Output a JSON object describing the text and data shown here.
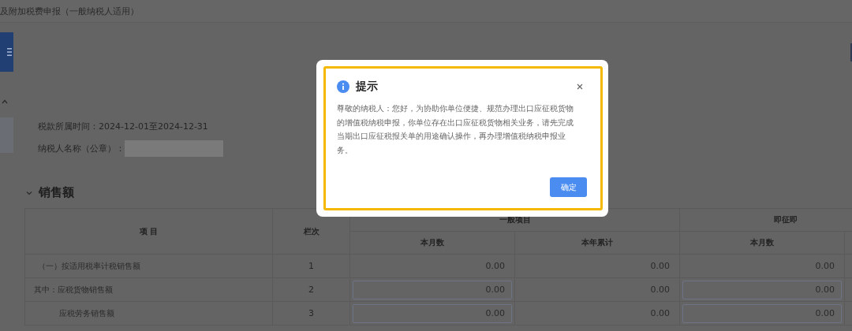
{
  "page": {
    "title": "及附加税费申报（一般纳税人适用）"
  },
  "info": {
    "period": "税款所属时间：2024-12-01至2024-12-31",
    "taxpayer_label": "纳税人名称（公章）："
  },
  "section": {
    "title": "销售额",
    "expanded": true
  },
  "table": {
    "item_header": "项 目",
    "line_header": "栏次",
    "groups": [
      {
        "title": "一般项目",
        "columns": [
          "本月数",
          "本年累计"
        ]
      },
      {
        "title": "即征即",
        "columns": [
          "本月数"
        ]
      }
    ],
    "rows": [
      {
        "kind": "main",
        "item": "（一）按适用税率计税销售额",
        "line": "1",
        "cells": [
          {
            "kind": "text",
            "value": "0.00"
          },
          {
            "kind": "text",
            "value": "0.00"
          },
          {
            "kind": "text",
            "value": "0.00"
          }
        ]
      },
      {
        "kind": "of_which",
        "item": "其中：应税货物销售额",
        "line": "2",
        "cells": [
          {
            "kind": "input",
            "value": "0.00"
          },
          {
            "kind": "text",
            "value": "0.00"
          },
          {
            "kind": "input",
            "value": "0.00"
          }
        ]
      },
      {
        "kind": "sub",
        "item": "应税劳务销售额",
        "line": "3",
        "cells": [
          {
            "kind": "input",
            "value": "0.00"
          },
          {
            "kind": "text",
            "value": "0.00"
          },
          {
            "kind": "input",
            "value": "0.00"
          }
        ]
      }
    ]
  },
  "dialog": {
    "title": "提示",
    "message": "尊敬的纳税人：您好，为协助你单位便捷、规范办理出口应征税货物的增值税纳税申报，你单位存在出口应征税货物相关业务，请先完成当期出口应征税报关单的用途确认操作，再办理增值税纳税申报业务。",
    "buttons": [
      "确定"
    ]
  }
}
